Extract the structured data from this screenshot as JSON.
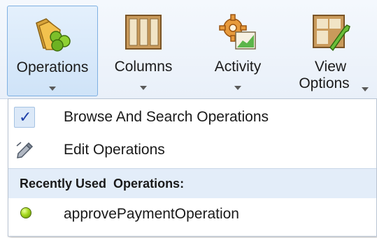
{
  "ribbon": {
    "buttons": [
      {
        "label": "Operations",
        "icon": "operations-folder-icon",
        "active": true
      },
      {
        "label": "Columns",
        "icon": "columns-icon",
        "active": false
      },
      {
        "label": "Activity",
        "icon": "activity-gear-icon",
        "active": false
      },
      {
        "label_line1": "View",
        "label_line2": "Options",
        "icon": "view-options-wrench-icon",
        "active": false
      }
    ]
  },
  "menu": {
    "items": [
      {
        "label": "Browse And Search Operations",
        "icon": "checkmark-icon",
        "checked": true
      },
      {
        "label": "Edit Operations",
        "icon": "edit-pencil-icon",
        "checked": false
      }
    ],
    "section_title": "Recently Used  Operations:",
    "recent": [
      {
        "label": "approvePaymentOperation",
        "icon": "green-dot-icon"
      }
    ]
  },
  "colors": {
    "accent_border": "#7fb0e2",
    "active_bg": "#cfe3f8",
    "section_bg": "#e3edf9",
    "check_color": "#1e3fa8",
    "dot_green": "#a6d81e"
  }
}
